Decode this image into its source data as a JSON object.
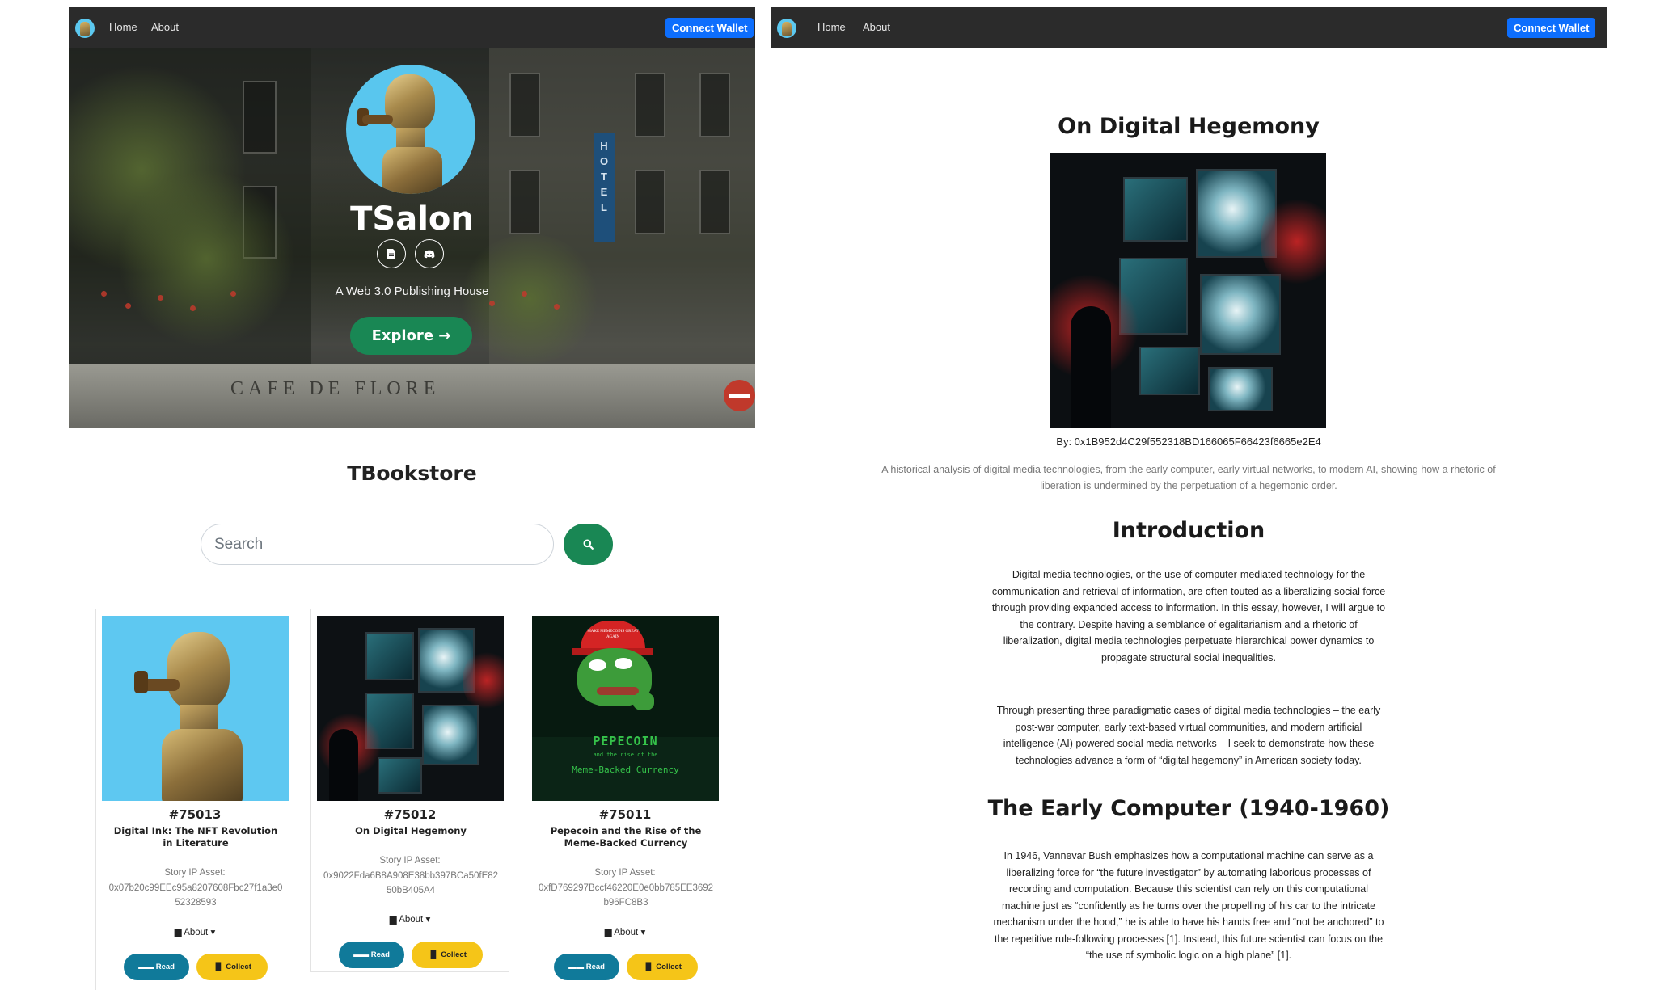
{
  "left": {
    "nav": {
      "home": "Home",
      "about": "About",
      "connect": "Connect Wallet"
    },
    "hero": {
      "title": "TSalon",
      "tagline": "A Web 3.0 Publishing House",
      "explore": "Explore →",
      "icons": [
        "document-icon",
        "discord-icon"
      ],
      "background_signs": {
        "hotel": "HOTEL",
        "cafe": "CAFE DE FLORE"
      }
    },
    "store": {
      "title": "TBookstore",
      "search_placeholder": "Search",
      "cards": [
        {
          "id": "#75013",
          "title": "Digital Ink: The NFT Revolution in Literature",
          "asset_label": "Story IP Asset:",
          "asset": "0x07b20c99EEc95a8207608Fbc27f1a3e052328593",
          "about": "About",
          "read": "Read",
          "collect": "Collect"
        },
        {
          "id": "#75012",
          "title": "On Digital Hegemony",
          "asset_label": "Story IP Asset:",
          "asset": "0x9022Fda6B8A908E38bb397BCa50fE8250bB405A4",
          "about": "About",
          "read": "Read",
          "collect": "Collect"
        },
        {
          "id": "#75011",
          "title": "Pepecoin and the Rise of the Meme-Backed Currency",
          "asset_label": "Story IP Asset:",
          "asset": "0xfD769297Bccf46220E0e0bb785EE3692b96FC8B3",
          "about": "About",
          "read": "Read",
          "collect": "Collect",
          "cover": {
            "hat_text": "MAKE MEMECOINS GREAT AGAIN",
            "headline": "PEPECOIN",
            "sub": "and the rise of the",
            "tagline": "Meme-Backed Currency"
          }
        }
      ]
    }
  },
  "right": {
    "nav": {
      "home": "Home",
      "about": "About",
      "connect": "Connect Wallet"
    },
    "article": {
      "title": "On Digital Hegemony",
      "byline": "By: 0x1B952d4C29f552318BD166065F66423f6665e2E4",
      "abstract": "A historical analysis of digital media technologies, from the early computer, early virtual networks, to modern AI, showing how a rhetoric of liberation is undermined by the perpetuation of a hegemonic order.",
      "sections": [
        {
          "heading": "Introduction",
          "paragraphs": [
            "Digital media technologies, or the use of computer-mediated technology for the communication and retrieval of information, are often touted as a liberalizing social force through providing expanded access to information. In this essay, however, I will argue to the contrary. Despite having a semblance of egalitarianism and a rhetoric of liberalization, digital media technologies perpetuate hierarchical power dynamics to propagate structural social inequalities.",
            "Through presenting three paradigmatic cases of digital media technologies – the early post-war computer, early text-based virtual communities, and modern artificial intelligence (AI) powered social media networks – I seek to demonstrate how these technologies advance a form of “digital hegemony” in American society today."
          ]
        },
        {
          "heading": "The Early Computer (1940-1960)",
          "paragraphs": [
            "In 1946, Vannevar Bush emphasizes how a computational machine can serve as a liberalizing force for “the future investigator” by automating laborious processes of recording and computation. Because this scientist can rely on this computational machine just as “confidently as he turns over the propelling of his car to the intricate mechanism under the hood,” he is able to have his hands free and “not be anchored” to the repetitive rule-following processes [1]. Instead, this future scientist can focus on the “the use of symbolic logic on a high plane” [1]."
          ]
        }
      ]
    }
  }
}
